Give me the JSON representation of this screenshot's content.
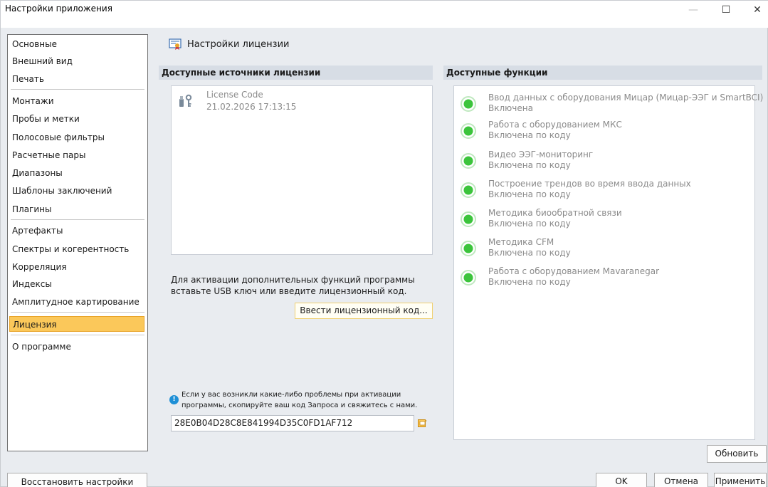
{
  "window": {
    "title": "Настройки приложения",
    "minimize_glyph": "—",
    "maximize_glyph": "☐",
    "close_glyph": "✕"
  },
  "sidebar": {
    "items": [
      {
        "label": "Основные"
      },
      {
        "label": "Внешний вид"
      },
      {
        "label": "Печать"
      },
      {
        "label": "Монтажи"
      },
      {
        "label": "Пробы и метки"
      },
      {
        "label": "Полосовые фильтры"
      },
      {
        "label": "Расчетные пары"
      },
      {
        "label": "Диапазоны"
      },
      {
        "label": "Шаблоны заключений"
      },
      {
        "label": "Плагины"
      },
      {
        "label": "Артефакты"
      },
      {
        "label": "Спектры и когерентность"
      },
      {
        "label": "Корреляция"
      },
      {
        "label": "Индексы"
      },
      {
        "label": "Амплитудное картирование"
      },
      {
        "label": "Лицензия"
      },
      {
        "label": "О программе"
      }
    ],
    "selected": "Лицензия",
    "restore_label": "Восстановить настройки"
  },
  "page": {
    "title": "Настройки лицензии",
    "icon": "license-certificate-icon"
  },
  "sources": {
    "header": "Доступные источники лицензии",
    "items": [
      {
        "name": "License Code",
        "date": "21.02.2026 17:13:15",
        "icon": "usb-key-icon"
      }
    ]
  },
  "features": {
    "header": "Доступные функции",
    "items": [
      {
        "name": "Ввод данных с оборудования Мицар (Мицар-ЭЭГ и SmartBCI)",
        "status": "Включена"
      },
      {
        "name": "Работа с оборудованием МКС",
        "status": "Включена по коду"
      },
      {
        "name": "Видео ЭЭГ-мониторинг",
        "status": "Включена по коду"
      },
      {
        "name": "Построение трендов во время ввода данных",
        "status": "Включена по коду"
      },
      {
        "name": "Методика биообратной связи",
        "status": "Включена по коду"
      },
      {
        "name": "Методика CFM",
        "status": "Включена по коду"
      },
      {
        "name": "Работа с оборудованием Mavaranegar",
        "status": "Включена по коду"
      }
    ],
    "status_color": "#3cc43c"
  },
  "activation": {
    "text": "Для активации дополнительных функций программы вставьте USB ключ или введите лицензионный код.",
    "enter_code_label": "Ввести лицензионный код..."
  },
  "support": {
    "note": "Если у вас возникли какие-либо проблемы при активации программы, скопируйте ваш код Запроса и свяжитесь с нами.",
    "request_code": "28E0B04D28C8E841994D35C0FD1AF712"
  },
  "buttons": {
    "refresh": "Обновить",
    "ok": "OK",
    "cancel": "Отмена",
    "apply": "Применить"
  },
  "colors": {
    "selected_bg": "#fbc85a",
    "section_header_bg": "#d7dde5",
    "window_bg": "#e9ecf0"
  }
}
